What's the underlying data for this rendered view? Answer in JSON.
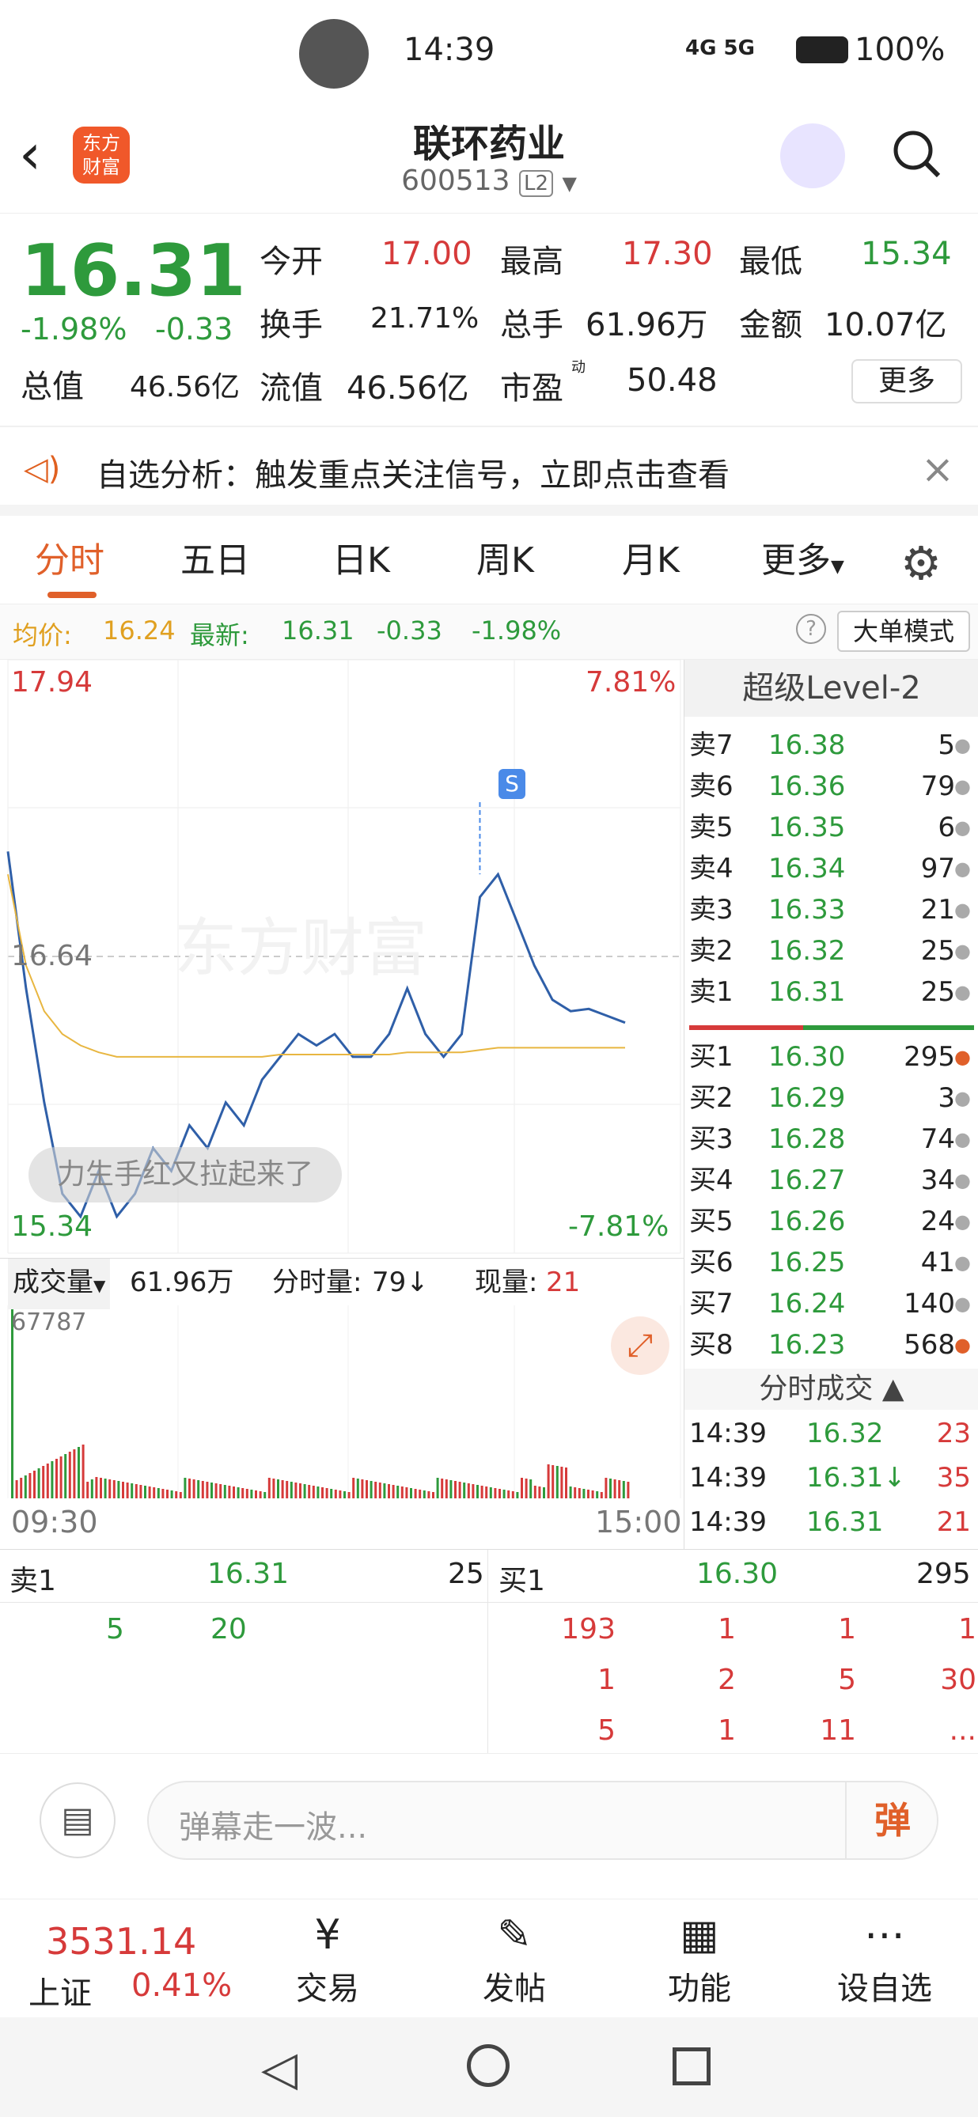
{
  "status_bar": {
    "time": "14:39",
    "signal": "4G 5G",
    "battery": "100%"
  },
  "header": {
    "title": "联环药业",
    "code": "600513",
    "level_badge": "L2",
    "logo_line1": "东方",
    "logo_line2": "财富"
  },
  "quote": {
    "price": "16.31",
    "change_pct": "-1.98%",
    "change": "-0.33",
    "open_label": "今开",
    "open": "17.00",
    "high_label": "最高",
    "high": "17.30",
    "low_label": "最低",
    "low": "15.34",
    "turnover_label": "换手",
    "turnover": "21.71%",
    "volume_label": "总手",
    "volume": "61.96万",
    "amount_label": "金额",
    "amount": "10.07亿",
    "mktcap_label": "总值",
    "mktcap": "46.56亿",
    "float_label": "流值",
    "float": "46.56亿",
    "pe_label": "市盈",
    "pe_sup": "动",
    "pe": "50.48",
    "more": "更多"
  },
  "alert": {
    "text": "自选分析：触发重点关注信号，立即点击查看"
  },
  "tabs": [
    "分时",
    "五日",
    "日K",
    "周K",
    "月K",
    "更多"
  ],
  "info_bar": {
    "avg_label": "均价:",
    "avg": "16.24",
    "latest_label": "最新:",
    "latest": "16.31",
    "chg": "-0.33",
    "pct": "-1.98%",
    "mode": "大单模式"
  },
  "chart": {
    "ymax": "17.94",
    "ymax_pct": "7.81%",
    "mid": "16.64",
    "ymin": "15.34",
    "ymin_pct": "-7.81%",
    "watermark": "东方财富",
    "marker": "S",
    "bullet": "力生手红又拉起来了",
    "vol_label": "成交量",
    "vol_total": "61.96万",
    "tick_label": "分时量:",
    "tick_val": "79↓",
    "cur_label": "现量:",
    "cur_val": "21",
    "vol_max": "67787",
    "time_start": "09:30",
    "time_end": "15:00"
  },
  "chart_data": {
    "type": "line",
    "title": "",
    "ylim": [
      15.34,
      17.94
    ],
    "x": [
      "09:30",
      "15:00"
    ],
    "series": [
      {
        "name": "",
        "values": [
          17.1,
          16.5,
          16.0,
          15.6,
          15.5,
          15.7,
          15.5,
          15.6,
          15.8,
          15.7,
          15.9,
          15.8,
          16.0,
          15.9,
          16.1,
          16.2,
          16.3,
          16.25,
          16.3,
          16.2,
          16.2,
          16.3,
          16.5,
          16.3,
          16.2,
          16.3,
          16.9,
          17.0,
          16.8,
          16.6,
          16.45,
          16.4,
          16.41,
          16.38,
          16.35
        ]
      },
      {
        "name": "",
        "values": [
          17.0,
          16.6,
          16.4,
          16.3,
          16.25,
          16.22,
          16.2,
          16.2,
          16.2,
          16.2,
          16.2,
          16.2,
          16.2,
          16.2,
          16.2,
          16.21,
          16.21,
          16.21,
          16.21,
          16.21,
          16.21,
          16.21,
          16.22,
          16.22,
          16.22,
          16.22,
          16.23,
          16.24,
          16.24,
          16.24,
          16.24,
          16.24,
          16.24,
          16.24,
          16.24
        ]
      }
    ]
  },
  "orderbook": {
    "title": "超级Level-2",
    "asks": [
      {
        "label": "卖7",
        "price": "16.38",
        "vol": "5"
      },
      {
        "label": "卖6",
        "price": "16.36",
        "vol": "79"
      },
      {
        "label": "卖5",
        "price": "16.35",
        "vol": "6"
      },
      {
        "label": "卖4",
        "price": "16.34",
        "vol": "97"
      },
      {
        "label": "卖3",
        "price": "16.33",
        "vol": "21"
      },
      {
        "label": "卖2",
        "price": "16.32",
        "vol": "25"
      },
      {
        "label": "卖1",
        "price": "16.31",
        "vol": "25"
      }
    ],
    "bids": [
      {
        "label": "买1",
        "price": "16.30",
        "vol": "295"
      },
      {
        "label": "买2",
        "price": "16.29",
        "vol": "3"
      },
      {
        "label": "买3",
        "price": "16.28",
        "vol": "74"
      },
      {
        "label": "买4",
        "price": "16.27",
        "vol": "34"
      },
      {
        "label": "买5",
        "price": "16.26",
        "vol": "24"
      },
      {
        "label": "买6",
        "price": "16.25",
        "vol": "41"
      },
      {
        "label": "买7",
        "price": "16.24",
        "vol": "140"
      },
      {
        "label": "买8",
        "price": "16.23",
        "vol": "568"
      }
    ],
    "ticks_title": "分时成交",
    "ticks": [
      {
        "time": "14:39",
        "price": "16.32",
        "vol": "23"
      },
      {
        "time": "14:39",
        "price": "16.31↓",
        "vol": "35"
      },
      {
        "time": "14:39",
        "price": "16.31",
        "vol": "21"
      }
    ]
  },
  "queue": {
    "sell_label": "卖1",
    "sell_price": "16.31",
    "sell_vol": "25",
    "buy_label": "买1",
    "buy_price": "16.30",
    "buy_vol": "295",
    "sell_orders": [
      "5",
      "20"
    ],
    "buy_orders": [
      "193",
      "1",
      "1",
      "1",
      "1",
      "2",
      "5",
      "30",
      "5",
      "1",
      "11",
      "..."
    ]
  },
  "comment": {
    "placeholder": "弹幕走一波...",
    "danmu": "弹"
  },
  "bottom_nav": {
    "index_value": "3531.14",
    "index_name": "上证",
    "index_pct": "0.41%",
    "items": [
      "交易",
      "发帖",
      "功能",
      "设自选"
    ]
  }
}
